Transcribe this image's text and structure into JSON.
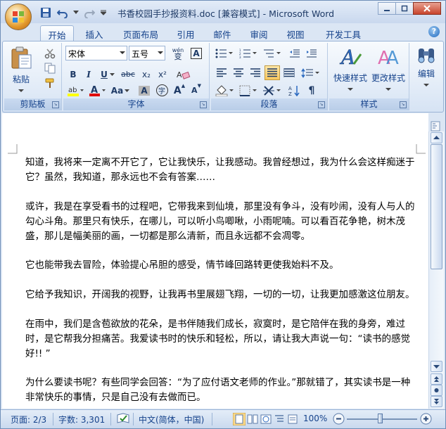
{
  "window": {
    "title": "书香校园手抄报资料.doc [兼容模式] - Microsoft Word"
  },
  "tabs": [
    "开始",
    "插入",
    "页面布局",
    "引用",
    "邮件",
    "审阅",
    "视图",
    "开发工具"
  ],
  "ribbon": {
    "clipboard": {
      "label": "剪贴板",
      "paste": "粘贴"
    },
    "font": {
      "label": "字体",
      "name": "宋体",
      "size": "五号",
      "wen": "wén",
      "wen_char": "变",
      "a_box": "A",
      "strike": "abc",
      "sub": "x₂",
      "sup": "x²",
      "aa": "Aa",
      "char_shade": "A",
      "enclose": "字",
      "grow": "A",
      "shrink": "A"
    },
    "paragraph": {
      "label": "段落"
    },
    "styles": {
      "label": "样式",
      "quick": "快速样式",
      "change": "更改样式"
    },
    "editing": {
      "label": "编辑"
    }
  },
  "document": {
    "paragraphs": [
      "知道，我将来一定离不开它了，它让我快乐，让我感动。我曾经想过，我为什么会这样痴迷于它？虽然，我知道，那永远也不会有答案……",
      "或许，我是在享受看书的过程吧，它带我来到仙境，那里没有争斗，没有吵闹，没有人与人的勾心斗角。那里只有快乐，在哪儿，可以听小鸟唧啾，小雨呢喃。可以看百花争艳，树木茂盛，那儿是幅美丽的画，一切都是那么清新，而且永远都不会凋零。",
      "它也能带我去冒险，体验提心吊胆的感受，情节峰回路转更使我始料不及。",
      "它给予我知识，开阔我的视野，让我再书里展翅飞翔，一切的一切，让我更加感激这位朋友。",
      "在雨中，我们是含苞欲放的花朵，是书伴随我们成长，寂寞时，是它陪伴在我的身旁，难过时，是它帮我分担痛苦。我爱读书时的快乐和轻松，所以，请让我大声说一句：“读书的感觉好!! ”",
      "为什么要读书呢？有些同学会回答：“为了应付语文老师的作业。”那就错了，其实读书是一种非常快乐的事情，只是自己没有去做而已。"
    ]
  },
  "status": {
    "page": "页面: 2/3",
    "words": "字数: 3,301",
    "language": "中文(简体，中国)",
    "zoom": "100%"
  }
}
